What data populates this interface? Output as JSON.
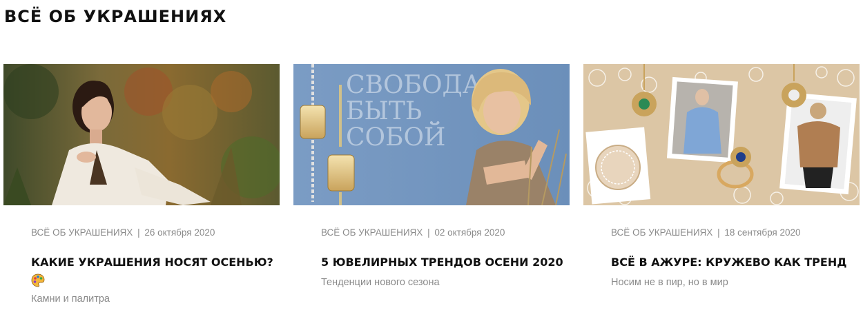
{
  "section": {
    "title": "ВСЁ ОБ УКРАШЕНИЯХ"
  },
  "cards": [
    {
      "category": "ВСЁ ОБ УКРАШЕНИЯХ",
      "separator": "|",
      "date": "26 октября 2020",
      "title": "КАКИЕ УКРАШЕНИЯ НОСЯТ ОСЕНЬЮ?",
      "title_icon": "palette-emoji-icon",
      "subtitle": "Камни и палитра",
      "image": "woman-autumn-plants-photo"
    },
    {
      "category": "ВСЁ ОБ УКРАШЕНИЯХ",
      "separator": "|",
      "date": "02 октября 2020",
      "title": "5 ЮВЕЛИРНЫХ ТРЕНДОВ ОСЕНИ 2020",
      "subtitle": "Тенденции нового сезона",
      "image": "blonde-woman-earrings-banner",
      "image_text": [
        "СВОБОДА",
        "БЫТЬ",
        "СОБОЙ"
      ]
    },
    {
      "category": "ВСЁ ОБ УКРАШЕНИЯХ",
      "separator": "|",
      "date": "18 сентября 2020",
      "title": "ВСЁ В АЖУРЕ: КРУЖЕВО КАК ТРЕНД",
      "subtitle": "Носим не в пир, но в мир",
      "image": "lace-collage-jewelry"
    }
  ],
  "colors": {
    "meta": "#8a8a8a",
    "title": "#111111",
    "banner_blue": "#6f93bd",
    "lace_beige": "#dcc6a5"
  }
}
